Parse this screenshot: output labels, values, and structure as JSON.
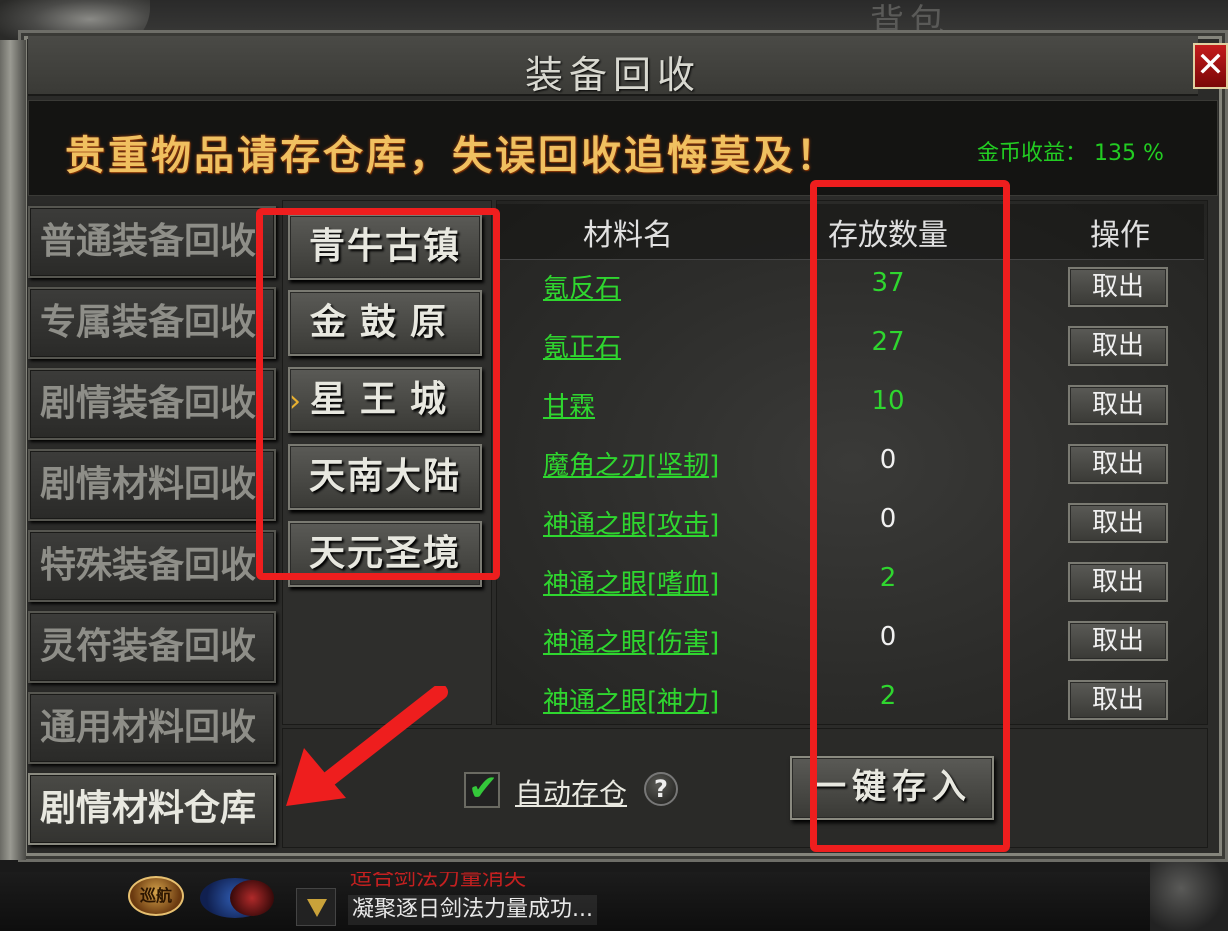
{
  "background": {
    "ghost_title": "背包",
    "mini_button_label": "巡航",
    "chat_line_top": "适合剑法力量消失",
    "chat_line": "凝聚逐日剑法力量成功..."
  },
  "window": {
    "title": "装备回收",
    "close_label": "✕",
    "banner_text": "贵重物品请存仓库，失误回收追悔莫及！",
    "gold_income_label": "金币收益： 135 %"
  },
  "categories": [
    {
      "label": "普通装备回收"
    },
    {
      "label": "专属装备回收"
    },
    {
      "label": "剧情装备回收"
    },
    {
      "label": "剧情材料回收"
    },
    {
      "label": "特殊装备回收"
    },
    {
      "label": "灵符装备回收"
    },
    {
      "label": "通用材料回收"
    },
    {
      "label": "剧情材料仓库"
    }
  ],
  "active_category": "剧情材料仓库",
  "regions": [
    {
      "label": "青牛古镇"
    },
    {
      "label": "金鼓原"
    },
    {
      "label": "星王城"
    },
    {
      "label": "天南大陆"
    },
    {
      "label": "天元圣境"
    }
  ],
  "selected_region": "星王城",
  "selected_marker": "›",
  "table": {
    "headers": {
      "name": "材料名",
      "quantity": "存放数量",
      "action": "操作"
    },
    "rows": [
      {
        "name": "氪反石",
        "quantity": "37",
        "action": "取出"
      },
      {
        "name": "氪正石",
        "quantity": "27",
        "action": "取出"
      },
      {
        "name": "甘霖",
        "quantity": "10",
        "action": "取出"
      },
      {
        "name": "魔角之刃[坚韧]",
        "quantity": "0",
        "action": "取出"
      },
      {
        "name": "神通之眼[攻击]",
        "quantity": "0",
        "action": "取出"
      },
      {
        "name": "神通之眼[嗜血]",
        "quantity": "2",
        "action": "取出"
      },
      {
        "name": "神通之眼[伤害]",
        "quantity": "0",
        "action": "取出"
      },
      {
        "name": "神通之眼[神力]",
        "quantity": "2",
        "action": "取出"
      }
    ]
  },
  "auto_store": {
    "checked": true,
    "label": "自动存仓",
    "help": "?"
  },
  "deposit_all_label": "一键存入",
  "colors": {
    "item_name": "#2fd62f",
    "qty_positive": "#2fd62f",
    "qty_zero": "#f0f0f0",
    "banner_text": "#f0c060",
    "annotation_red": "#ee1e1e"
  }
}
